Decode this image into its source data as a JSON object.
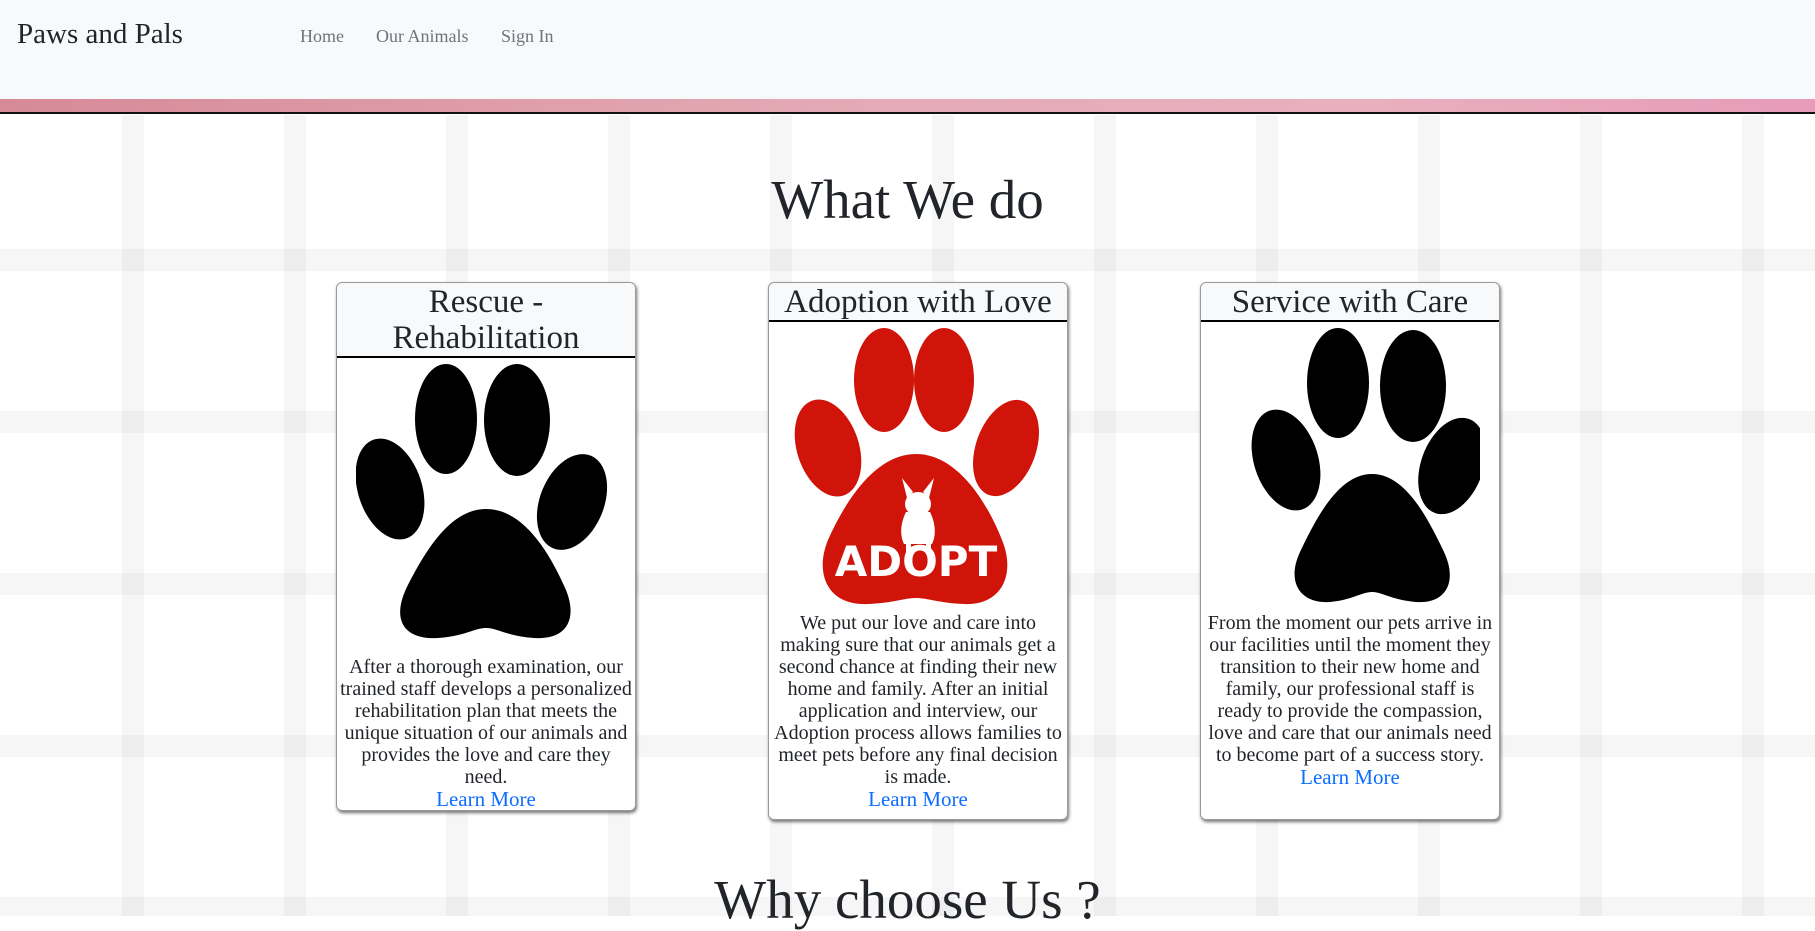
{
  "nav": {
    "brand": "Paws and Pals",
    "links": [
      "Home",
      "Our Animals",
      "Sign In"
    ]
  },
  "main": {
    "title": "What We do",
    "next_title": "Why choose Us ?"
  },
  "cards": [
    {
      "title_line1": "Rescue -",
      "title_line2": "Rehabilitation",
      "image": "black-paw-icon",
      "text": "After a thorough examination, our trained staff develops a personalized rehabilitation plan that meets the unique situation of our animals and provides the love and care they need.",
      "link": "Learn More"
    },
    {
      "title": "Adoption with Love",
      "image": "red-adopt-paw-icon",
      "badge": "ADOPT",
      "text": "We put our love and care into making sure that our animals get a second chance at finding their new home and family. After an initial application and interview, our Adoption process allows families to meet pets before any final decision is made.",
      "link": "Learn More"
    },
    {
      "title": "Service with Care",
      "image": "black-paw-icon",
      "text": "From the moment our pets arrive in our facilities until the moment they transition to their new home and family, our professional staff is ready to provide the compassion, love and care that our animals need to become part of a success story.",
      "link": "Learn More"
    }
  ],
  "colors": {
    "link": "#0d6efd",
    "paw_black": "#000000",
    "paw_red": "#d0140a",
    "navbar_bg": "#f8f9fa"
  }
}
